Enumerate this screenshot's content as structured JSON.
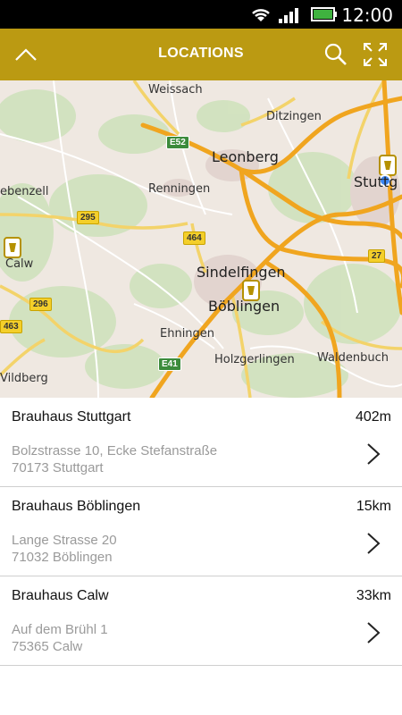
{
  "status_bar": {
    "time": "12:00",
    "icons": [
      "wifi-icon",
      "signal-icon",
      "battery-icon"
    ]
  },
  "app_bar": {
    "title": "LOCATIONS",
    "icons": [
      "chevron-up-icon",
      "search-icon",
      "expand-icon"
    ],
    "color": "#bb9a12"
  },
  "map": {
    "labels": {
      "weissach": "Weissach",
      "ditzingen": "Ditzingen",
      "leonberg": "Leonberg",
      "stuttgart": "Stuttg",
      "renningen": "Renningen",
      "ebenzell": "ebenzell",
      "calw": "Calw",
      "sindelfingen": "Sindelfingen",
      "boeblingen": "Böblingen",
      "ehningen": "Ehningen",
      "holzgerlingen": "Holzgerlingen",
      "waldenbuch": "Waldenbuch",
      "wildberg": "Vildberg"
    },
    "road_shields": {
      "e52": "E52",
      "r295": "295",
      "r464": "464",
      "r27": "27",
      "r296": "296",
      "r463": "463",
      "e41": "E41"
    }
  },
  "locations": [
    {
      "name": "Brauhaus Stuttgart",
      "distance": "402m",
      "street": "Bolzstrasse 10, Ecke Stefanstraße",
      "city": "70173 Stuttgart"
    },
    {
      "name": "Brauhaus Böblingen",
      "distance": "15km",
      "street": "Lange Strasse 20",
      "city": "71032 Böblingen"
    },
    {
      "name": "Brauhaus Calw",
      "distance": "33km",
      "street": "Auf dem Brühl 1",
      "city": "75365 Calw"
    }
  ]
}
